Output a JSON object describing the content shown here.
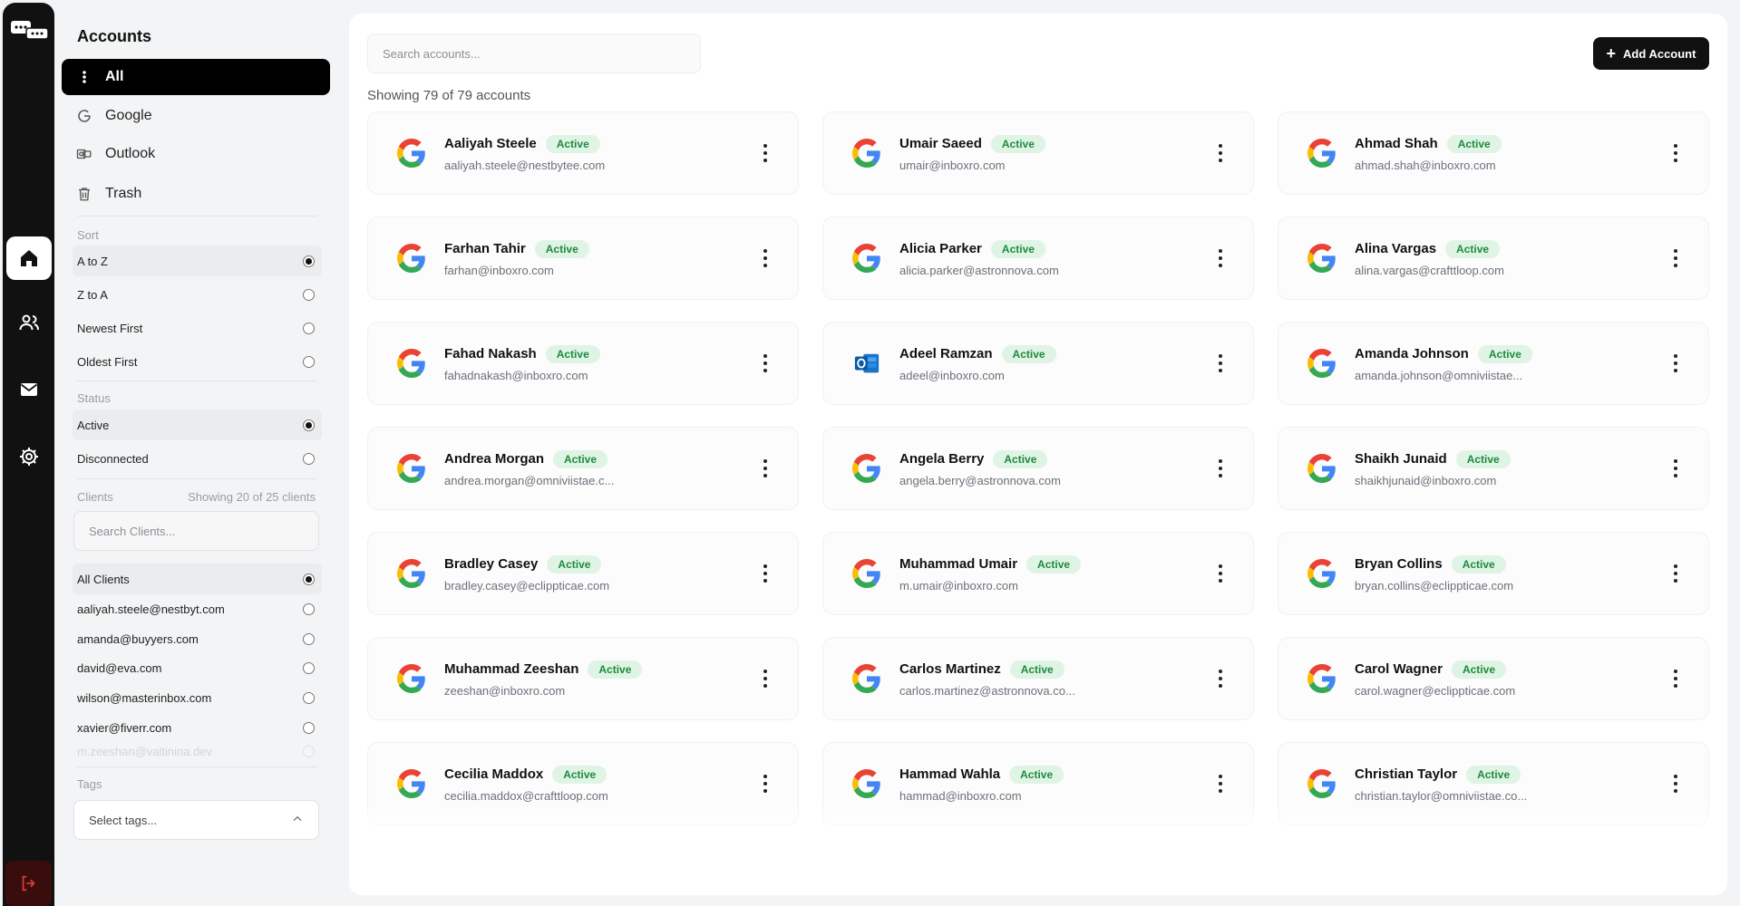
{
  "sidebar": {
    "title": "Accounts",
    "nav": [
      {
        "label": "All",
        "icon": "grip-icon"
      },
      {
        "label": "Google",
        "icon": "google-icon"
      },
      {
        "label": "Outlook",
        "icon": "outlook-icon"
      },
      {
        "label": "Trash",
        "icon": "trash-icon"
      }
    ],
    "sort": {
      "label": "Sort",
      "options": [
        "A to Z",
        "Z to A",
        "Newest First",
        "Oldest First"
      ],
      "selected": "A to Z"
    },
    "status": {
      "label": "Status",
      "options": [
        "Active",
        "Disconnected"
      ],
      "selected": "Active"
    },
    "clients": {
      "label": "Clients",
      "count_text": "Showing 20 of 25 clients",
      "search_placeholder": "Search Clients...",
      "options": [
        "All Clients",
        "aaliyah.steele@nestbyt.com",
        "amanda@buyyers.com",
        "david@eva.com",
        "wilson@masterinbox.com",
        "xavier@fiverr.com",
        "m.zeeshan@valtinina.dev"
      ],
      "selected": "All Clients"
    },
    "tags": {
      "label": "Tags",
      "placeholder": "Select tags..."
    }
  },
  "rail": {
    "items": [
      "logo-icon",
      "home-icon",
      "users-icon",
      "mail-icon",
      "settings-icon",
      "logout-icon"
    ],
    "active": "home-icon"
  },
  "main": {
    "search_placeholder": "Search accounts...",
    "add_button": "Add Account",
    "showing_text": "Showing 79 of 79 accounts",
    "status_badge": "Active",
    "accounts": [
      {
        "name": "Aaliyah Steele",
        "email": "aaliyah.steele@nestbytee.com",
        "provider": "google"
      },
      {
        "name": "Umair Saeed",
        "email": "umair@inboxro.com",
        "provider": "google"
      },
      {
        "name": "Ahmad Shah",
        "email": "ahmad.shah@inboxro.com",
        "provider": "google"
      },
      {
        "name": "Farhan Tahir",
        "email": "farhan@inboxro.com",
        "provider": "google"
      },
      {
        "name": "Alicia Parker",
        "email": "alicia.parker@astronnova.com",
        "provider": "google"
      },
      {
        "name": "Alina Vargas",
        "email": "alina.vargas@crafttloop.com",
        "provider": "google"
      },
      {
        "name": "Fahad Nakash",
        "email": "fahadnakash@inboxro.com",
        "provider": "google"
      },
      {
        "name": "Adeel Ramzan",
        "email": "adeel@inboxro.com",
        "provider": "outlook"
      },
      {
        "name": "Amanda Johnson",
        "email": "amanda.johnson@omniviistae...",
        "provider": "google"
      },
      {
        "name": "Andrea Morgan",
        "email": "andrea.morgan@omniviistae.c...",
        "provider": "google"
      },
      {
        "name": "Angela Berry",
        "email": "angela.berry@astronnova.com",
        "provider": "google"
      },
      {
        "name": "Shaikh Junaid",
        "email": "shaikhjunaid@inboxro.com",
        "provider": "google"
      },
      {
        "name": "Bradley Casey",
        "email": "bradley.casey@eclippticae.com",
        "provider": "google"
      },
      {
        "name": "Muhammad Umair",
        "email": "m.umair@inboxro.com",
        "provider": "google"
      },
      {
        "name": "Bryan Collins",
        "email": "bryan.collins@eclippticae.com",
        "provider": "google"
      },
      {
        "name": "Muhammad Zeeshan",
        "email": "zeeshan@inboxro.com",
        "provider": "google"
      },
      {
        "name": "Carlos Martinez",
        "email": "carlos.martinez@astronnova.co...",
        "provider": "google"
      },
      {
        "name": "Carol Wagner",
        "email": "carol.wagner@eclippticae.com",
        "provider": "google"
      },
      {
        "name": "Cecilia Maddox",
        "email": "cecilia.maddox@crafttloop.com",
        "provider": "google"
      },
      {
        "name": "Hammad Wahla",
        "email": "hammad@inboxro.com",
        "provider": "google"
      },
      {
        "name": "Christian Taylor",
        "email": "christian.taylor@omniviistae.co...",
        "provider": "google"
      }
    ]
  },
  "colors": {
    "rail_bg": "#111111",
    "active_badge_bg": "#dff4e4",
    "active_badge_text": "#1e8a3f",
    "logout_bg": "#3a0d0d"
  }
}
